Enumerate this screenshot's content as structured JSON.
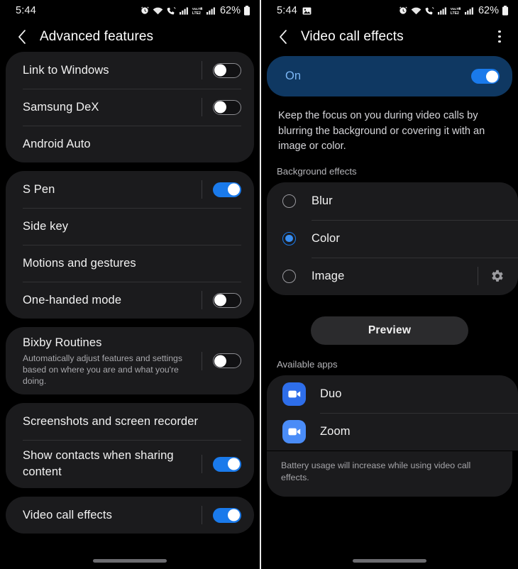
{
  "left": {
    "statusbar": {
      "time": "5:44",
      "battery": "62%",
      "icons": [
        "alarm-icon",
        "wifi-icon",
        "call-wifi-icon",
        "signal-bars-icon",
        "volte-lte2-icon",
        "signal-bars-2-icon",
        "battery-icon"
      ]
    },
    "appbar": {
      "title": "Advanced features",
      "back_icon": "back-chevron-icon"
    },
    "groups": [
      {
        "rows": [
          {
            "title": "Link to Windows",
            "toggle": "off"
          },
          {
            "title": "Samsung DeX",
            "toggle": "off"
          },
          {
            "title": "Android Auto",
            "toggle": null
          }
        ]
      },
      {
        "rows": [
          {
            "title": "S Pen",
            "toggle": "on"
          },
          {
            "title": "Side key",
            "toggle": null
          },
          {
            "title": "Motions and gestures",
            "toggle": null
          },
          {
            "title": "One-handed mode",
            "toggle": "off"
          }
        ]
      },
      {
        "rows": [
          {
            "title": "Bixby Routines",
            "subtitle": "Automatically adjust features and settings based on where you are and what you're doing.",
            "toggle": "off"
          }
        ]
      },
      {
        "rows": [
          {
            "title": "Screenshots and screen recorder",
            "toggle": null
          },
          {
            "title": "Show contacts when sharing content",
            "toggle": "on"
          }
        ]
      },
      {
        "rows": [
          {
            "title": "Video call effects",
            "toggle": "on"
          }
        ]
      }
    ]
  },
  "right": {
    "statusbar": {
      "time": "5:44",
      "battery": "62%",
      "gallery_icon": "image-icon"
    },
    "appbar": {
      "title": "Video call effects",
      "back_icon": "back-chevron-icon",
      "menu_icon": "kebab-menu-icon"
    },
    "banner": {
      "label": "On",
      "toggle": "on"
    },
    "description": "Keep the focus on you during video calls by blurring the background or covering it with an image or color.",
    "background_effects": {
      "label": "Background effects",
      "options": [
        {
          "label": "Blur",
          "selected": false,
          "gear": false
        },
        {
          "label": "Color",
          "selected": true,
          "gear": false
        },
        {
          "label": "Image",
          "selected": false,
          "gear": true
        }
      ]
    },
    "preview_button": "Preview",
    "available_apps": {
      "label": "Available apps",
      "apps": [
        {
          "name": "Duo",
          "icon": "video-camera-icon",
          "color": "#2e6eea"
        },
        {
          "name": "Zoom",
          "icon": "video-camera-icon",
          "color": "#4a8cf7"
        }
      ]
    },
    "footnote": "Battery usage will increase while using video call effects."
  },
  "colors": {
    "accent_blue": "#1a7aeb",
    "banner_bg": "#0f3862",
    "banner_text": "#7cb6f5",
    "card_bg": "#1b1b1d",
    "page_bg": "#000000"
  }
}
